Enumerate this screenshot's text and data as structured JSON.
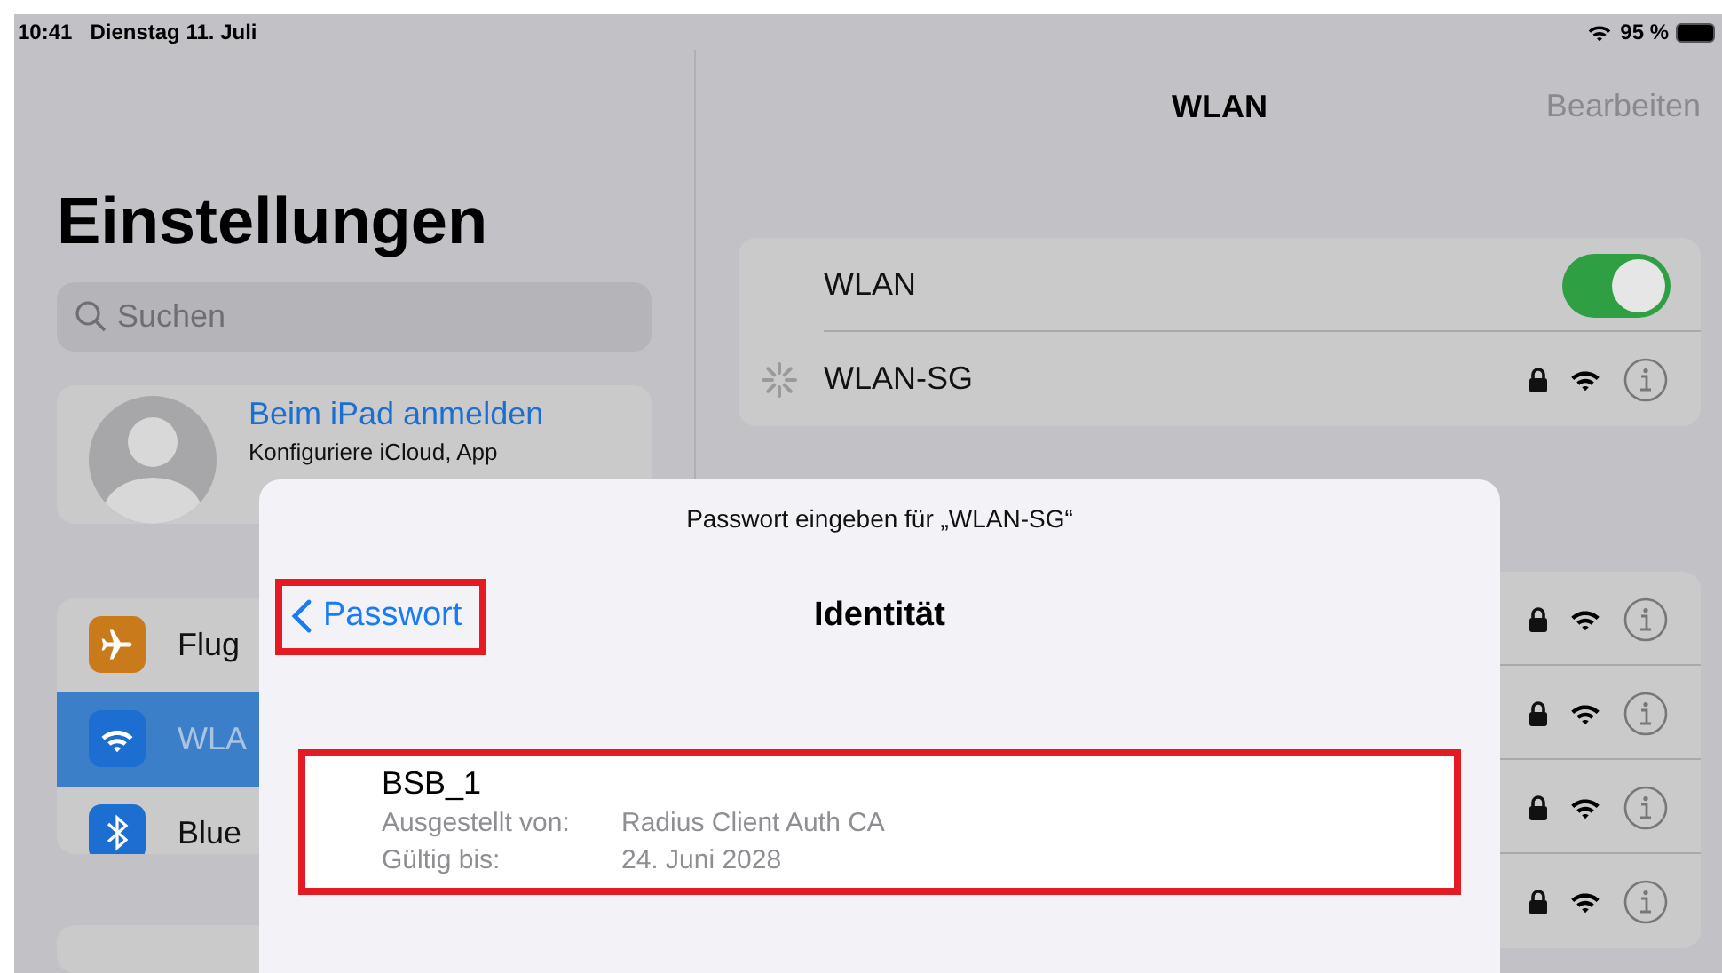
{
  "status_bar": {
    "time": "10:41",
    "date": "Dienstag 11. Juli",
    "battery": "95 %"
  },
  "sidebar": {
    "title": "Einstellungen",
    "search": {
      "placeholder": "Suchen"
    },
    "account": {
      "title": "Beim iPad anmelden",
      "subtitle": "Konfiguriere iCloud, App"
    },
    "items": [
      {
        "kind": "airplane",
        "label": "Flug",
        "color": "#c97a1a",
        "selected": false
      },
      {
        "kind": "wifi",
        "label": "WLA",
        "color": "#1c6fd0",
        "selected": true
      },
      {
        "kind": "bluetooth",
        "label": "Blue",
        "color": "#1c6fd0",
        "selected": false
      }
    ]
  },
  "detail": {
    "title": "WLAN",
    "edit": "Bearbeiten",
    "wlan_toggle": {
      "label": "WLAN",
      "on": true
    },
    "current_network": {
      "name": "WLAN-SG",
      "connecting": true,
      "secured": true
    },
    "other_networks": [
      {
        "secured": true
      },
      {
        "secured": true
      },
      {
        "secured": true
      },
      {
        "secured": true
      }
    ]
  },
  "sheet": {
    "prompt": "Passwort eingeben für „WLAN-SG“",
    "back": {
      "label": "Passwort",
      "highlighted": true
    },
    "title": "Identität",
    "certificate": {
      "name": "BSB_1",
      "highlighted": true,
      "fields": [
        {
          "label": "Ausgestellt von:",
          "value": "Radius Client Auth CA"
        },
        {
          "label": "Gültig bis:",
          "value": "24. Juni 2028"
        }
      ]
    }
  }
}
